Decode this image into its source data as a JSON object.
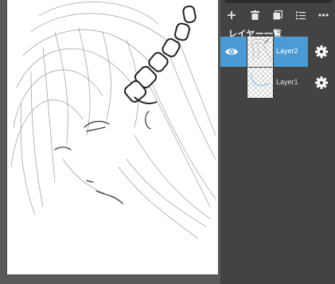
{
  "panel": {
    "title": "レイヤー一覧",
    "toolbar": [
      {
        "icon": "add-icon"
      },
      {
        "icon": "trash-icon"
      },
      {
        "icon": "duplicate-icon"
      },
      {
        "icon": "list-icon"
      },
      {
        "icon": "more-icon"
      }
    ],
    "layers": [
      {
        "name": "Layer2",
        "selected": true,
        "visible": true
      },
      {
        "name": "Layer1",
        "selected": false,
        "visible": false
      }
    ]
  },
  "colors": {
    "selection": "#4b9ad5",
    "panel_bg": "#434343",
    "workspace_bg": "#5a5a5a",
    "canvas_bg": "#ffffff"
  }
}
